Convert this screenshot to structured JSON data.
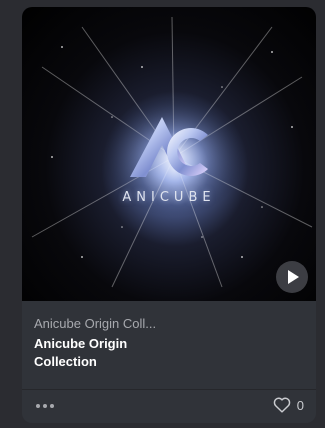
{
  "card": {
    "media_brand_text": "ANICUBE",
    "collection_name": "Anicube Origin Coll...",
    "item_title": "Anicube Origin Collection",
    "favorite_count": "0",
    "icons": {
      "play": "play-icon",
      "more": "more-horizontal-icon",
      "favorite": "heart-outline-icon"
    }
  },
  "colors": {
    "page_background": "#2b2c31",
    "card_background": "#303339",
    "title_text": "#ffffff",
    "secondary_text": "#a7a9ae"
  }
}
